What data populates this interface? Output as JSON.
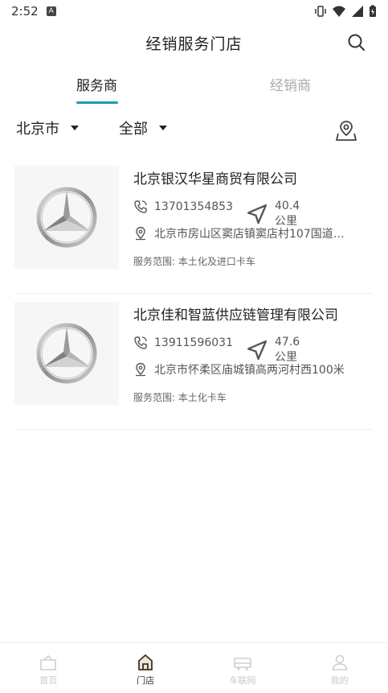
{
  "status": {
    "time": "2:52",
    "app_badge": "A"
  },
  "header": {
    "title": "经销服务门店"
  },
  "tabs": [
    {
      "label": "服务商",
      "active": true
    },
    {
      "label": "经销商",
      "active": false
    }
  ],
  "filters": {
    "city": "北京市",
    "category": "全部"
  },
  "stores": [
    {
      "name": "北京银汉华星商贸有限公司",
      "phone": "13701354853",
      "distance": "40.4公里",
      "address": "北京市房山区窦店镇窦店村107国道…",
      "scope": "服务范围: 本土化及进口卡车"
    },
    {
      "name": "北京佳和智蓝供应链管理有限公司",
      "phone": "13911596031",
      "distance": "47.6公里",
      "address": "北京市怀柔区庙城镇高两河村西100米",
      "scope": "服务范围: 本土化卡车"
    }
  ],
  "nav": [
    {
      "label": "首页",
      "icon": "home-icon",
      "active": false
    },
    {
      "label": "门店",
      "icon": "store-icon",
      "active": true
    },
    {
      "label": "车联网",
      "icon": "truck-icon",
      "active": false
    },
    {
      "label": "我的",
      "icon": "user-icon",
      "active": false
    }
  ],
  "colors": {
    "accent": "#1d9bb4",
    "inactive": "#aaaaaa"
  }
}
